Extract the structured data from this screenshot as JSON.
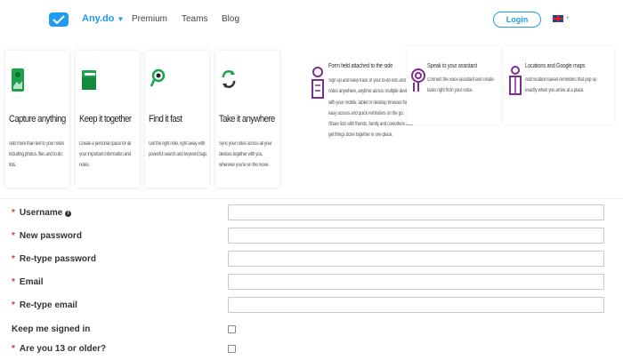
{
  "nav": {
    "brand": "Any.do",
    "links": [
      "Premium",
      "Teams",
      "Blog"
    ],
    "login": "Login"
  },
  "features": [
    {
      "title": "Capture anything",
      "desc": "Add more than text to your notes including photos, files and to-do lists."
    },
    {
      "title": "Keep it together",
      "desc": "Create a personal space for all your important information and notes."
    },
    {
      "title": "Find it fast",
      "desc": "Get the right note, right away with powerful search and keyword tags."
    },
    {
      "title": "Take it anywhere",
      "desc": "Sync your notes across all your devices together with you, wherever you're on the move."
    }
  ],
  "panels": [
    {
      "title": "Form field attached to the side",
      "text": "Sign up and keep track of your to-do lists and notes anywhere, anytime across multiple devices, with your mobile, tablet or desktop browser for easy access and quick reminders on the go. Share lists with friends, family and coworkers and get things done together in one place."
    },
    {
      "title": "Speak to your assistant",
      "text": "Connect the voice assistant and create tasks right from your voice."
    },
    {
      "title": "Locations and Google maps",
      "text": "Add location based reminders that pop up exactly when you arrive at a place."
    }
  ],
  "form": {
    "fields": [
      {
        "label": "Username",
        "info": "i"
      },
      {
        "label": "New password"
      },
      {
        "label": "Re-type password"
      },
      {
        "label": "Email"
      },
      {
        "label": "Re-type email"
      }
    ],
    "required_marker": "*",
    "keep_signed_in": "Keep me signed in",
    "age_check": "Are you 13 or older?"
  },
  "colors": {
    "brand": "#1f9bf0",
    "required": "#d43a3a",
    "purple": "#7b2f8f",
    "green": "#1aa34a"
  }
}
